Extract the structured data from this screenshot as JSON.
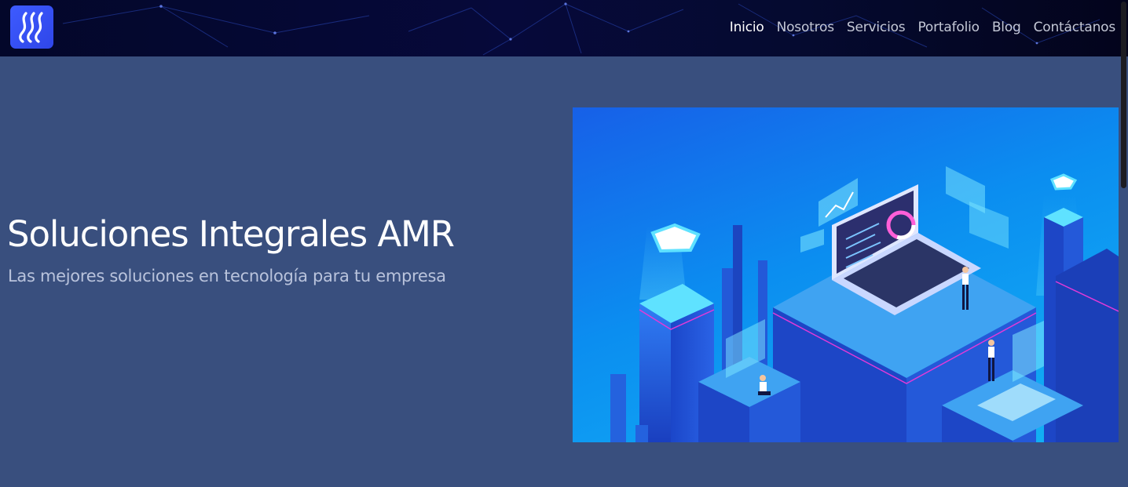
{
  "header": {
    "logo_icon": "waves-icon",
    "nav": [
      {
        "label": "Inicio",
        "active": true
      },
      {
        "label": "Nosotros",
        "active": false
      },
      {
        "label": "Servicios",
        "active": false
      },
      {
        "label": "Portafolio",
        "active": false
      },
      {
        "label": "Blog",
        "active": false
      },
      {
        "label": "Contáctanos",
        "active": false
      }
    ]
  },
  "hero": {
    "title": "Soluciones Integrales AMR",
    "subtitle": "Las mejores soluciones en tecnología para tu empresa",
    "illustration": "isometric-tech-city-laptop-illustration"
  },
  "colors": {
    "navbar_bg": "#050a30",
    "page_bg": "#394f7e",
    "logo_bg": "#3d5bff",
    "nav_text": "#c4c8d6",
    "nav_active": "#ffffff",
    "subtitle_text": "#b9c3dc"
  }
}
